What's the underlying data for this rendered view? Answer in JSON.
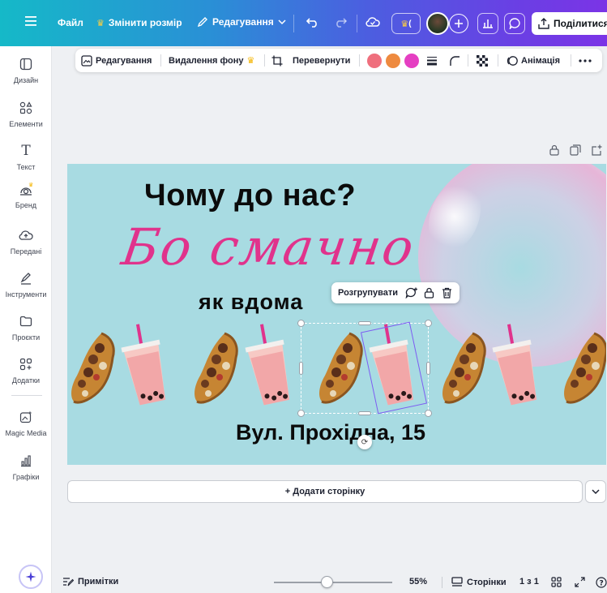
{
  "topbar": {
    "file_label": "Файл",
    "resize_label": "Змінити розмір",
    "edit_label": "Редагування",
    "share_label": "Поділитися"
  },
  "sidebar": {
    "items": [
      {
        "label": "Дизайн",
        "icon": "layout-icon"
      },
      {
        "label": "Елементи",
        "icon": "shapes-icon"
      },
      {
        "label": "Текст",
        "icon": "text-icon"
      },
      {
        "label": "Бренд",
        "icon": "brand-icon"
      },
      {
        "label": "Передані",
        "icon": "cloud-upload-icon"
      },
      {
        "label": "Інструменти",
        "icon": "pen-tool-icon"
      },
      {
        "label": "Проєкти",
        "icon": "folder-icon"
      },
      {
        "label": "Додатки",
        "icon": "apps-icon"
      },
      {
        "label": "Magic Media",
        "icon": "magic-media-icon"
      },
      {
        "label": "Графіки",
        "icon": "charts-icon"
      }
    ]
  },
  "context_toolbar": {
    "edit_label": "Редагування",
    "bg_remove_label": "Видалення фону",
    "flip_label": "Перевернути",
    "animation_label": "Анімація",
    "colors": [
      "#ef6f7d",
      "#ee8a3f",
      "#e53fc2"
    ]
  },
  "canvas": {
    "heading": "Чому до нас?",
    "script": "Бо смачно",
    "subheading": "як вдома",
    "address": "Вул. Прохідна, 15",
    "background": "#a8dbe2",
    "accent": "#e0338c"
  },
  "group_bar": {
    "ungroup_label": "Розгрупувати"
  },
  "add_page_label": "+ Додати сторінку",
  "bottom": {
    "notes_label": "Примітки",
    "zoom": "55%",
    "pages_label": "Сторінки",
    "page_count": "1 з 1"
  }
}
